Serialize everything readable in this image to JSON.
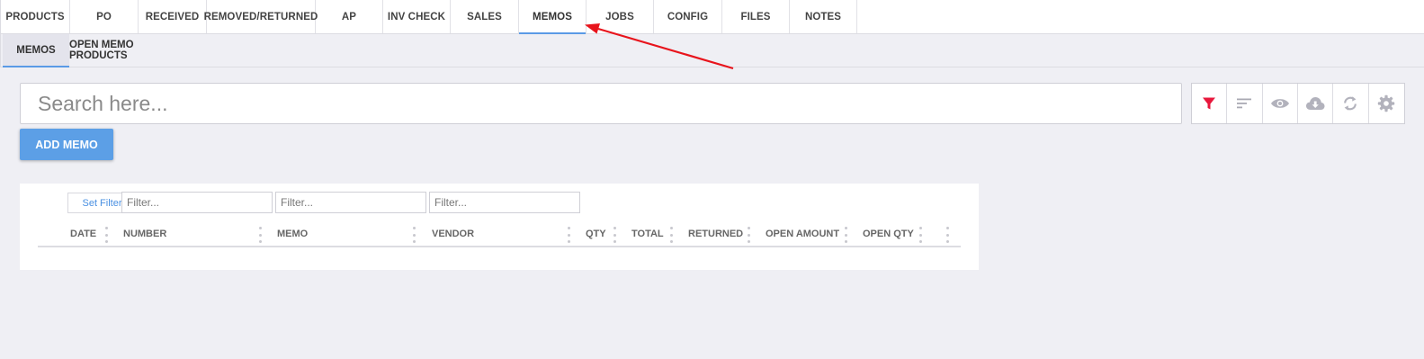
{
  "top_tabs": [
    "PRODUCTS",
    "PO",
    "RECEIVED",
    "REMOVED/RETURNED",
    "AP",
    "INV CHECK",
    "SALES",
    "MEMOS",
    "JOBS",
    "CONFIG",
    "FILES",
    "NOTES"
  ],
  "active_top_tab": "MEMOS",
  "sub_tabs": [
    "MEMOS",
    "OPEN MEMO PRODUCTS"
  ],
  "active_sub_tab": "MEMOS",
  "search": {
    "placeholder": "Search here...",
    "value": ""
  },
  "toolbar_icons": [
    "filter-icon",
    "sort-icon",
    "eye-icon",
    "cloud-download-icon",
    "sync-icon",
    "gear-icon"
  ],
  "add_button_label": "ADD MEMO",
  "table": {
    "set_filter_label": "Set Filter",
    "filter_placeholders": [
      "Filter...",
      "Filter...",
      "Filter..."
    ],
    "columns": [
      "DATE",
      "NUMBER",
      "MEMO",
      "VENDOR",
      "QTY",
      "TOTAL",
      "RETURNED",
      "OPEN AMOUNT",
      "OPEN QTY"
    ]
  },
  "colors": {
    "accent": "#5c9fe6",
    "filter_active": "#e8173c",
    "annotation_arrow": "#e8141c"
  }
}
